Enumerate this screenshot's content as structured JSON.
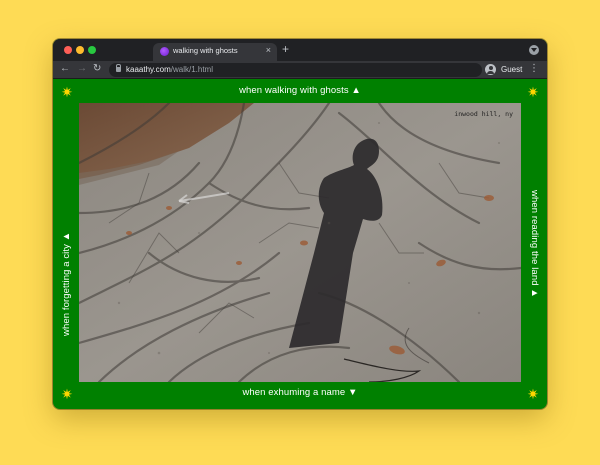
{
  "browser": {
    "tab_title": "walking with ghosts",
    "tab_close": "×",
    "new_tab": "+",
    "url_host": "kaaathy.com",
    "url_path": "/walk/1.html",
    "profile_label": "Guest",
    "back": "←",
    "forward": "→",
    "reload": "↻",
    "menu": "⋮"
  },
  "page": {
    "star": "✷",
    "star_color": "#ffd600",
    "background_color": "#008000",
    "nav_top": "when walking with ghosts ▲",
    "nav_bottom": "when exhuming a name ▼",
    "nav_left": "when forgetting a city ▲",
    "nav_right": "when reading the land ▲",
    "photo_caption": "inwood hill, ny"
  },
  "icons": [
    "close-icon",
    "plus-icon",
    "back-arrow-icon",
    "forward-arrow-icon",
    "reload-icon",
    "lock-icon",
    "profile-icon",
    "more-menu-icon",
    "star-icon"
  ]
}
